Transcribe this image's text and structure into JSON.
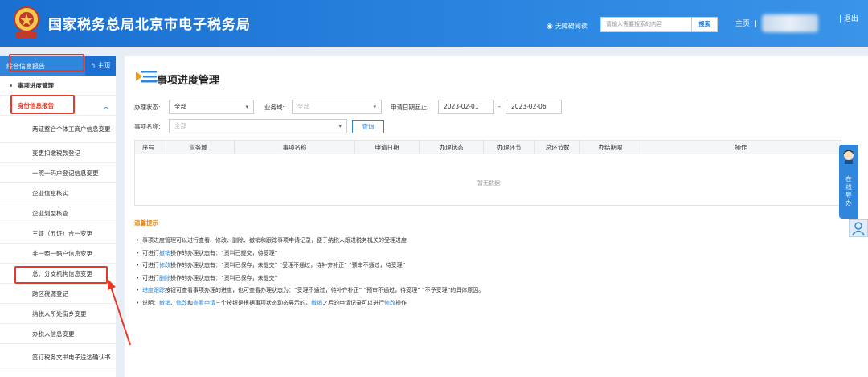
{
  "header": {
    "site_title": "国家税务总局北京市电子税务局",
    "accessibility": "无障碍阅读",
    "search_placeholder": "请输入需要搜索的内容",
    "search_button": "搜索",
    "home": "主页",
    "separator": "|",
    "logout": "| 退出"
  },
  "sidebar": {
    "head_title": "综合信息报告",
    "home_button": "主页",
    "items": [
      {
        "label": "事项进度管理",
        "level": 1
      },
      {
        "label": "身份信息报告",
        "level": 1,
        "expanded": true
      },
      {
        "label": "两证整合个体工商户信息变更",
        "level": 2
      },
      {
        "label": "变更扣缴税款登记",
        "level": 2
      },
      {
        "label": "一照一码户登记信息变更",
        "level": 2
      },
      {
        "label": "企业信息核实",
        "level": 2
      },
      {
        "label": "企业划型核查",
        "level": 2
      },
      {
        "label": "三证（五证）合一变更",
        "level": 2
      },
      {
        "label": "非一照一码户信息变更",
        "level": 2
      },
      {
        "label": "总、分支机构信息变更",
        "level": 2
      },
      {
        "label": "跨区税源登记",
        "level": 2
      },
      {
        "label": "纳税人所处街乡变更",
        "level": 2
      },
      {
        "label": "办税人信息变更",
        "level": 2
      },
      {
        "label": "签订税务文书电子送达确认书",
        "level": 2
      }
    ]
  },
  "main": {
    "page_title": "事项进度管理",
    "filters": {
      "status_label": "办理状态:",
      "status_value": "全部",
      "domain_label": "业务域:",
      "domain_value": "全部",
      "date_label": "申请日期起止:",
      "date_from": "2023-02-01",
      "date_sep": "-",
      "date_to": "2023-02-06",
      "name_label": "事项名称:",
      "name_value": "全部",
      "query_button": "查询"
    },
    "table": {
      "columns": [
        "序号",
        "业务域",
        "事项名称",
        "申请日期",
        "办理状态",
        "办理环节",
        "总环节数",
        "办结期限",
        "操作"
      ],
      "empty_text": "暂无数据"
    },
    "notice_title": "温馨提示",
    "notes": [
      {
        "parts": [
          {
            "t": "事项进度管理可以进行查看、修改、删除、撤销和跟踪事项申请记录，便于纳税人跟进税务机关的受理进度"
          }
        ]
      },
      {
        "parts": [
          {
            "t": "可进行"
          },
          {
            "t": "撤销",
            "hl": true
          },
          {
            "t": "操作的办理状态有：“资料已提交，待受理”"
          }
        ]
      },
      {
        "parts": [
          {
            "t": "可进行"
          },
          {
            "t": "修改",
            "hl": true
          },
          {
            "t": "操作的办理状态有：“资料已保存，未提交”  “受理不通过，待补齐补正”  “预审不通过，待受理”"
          }
        ]
      },
      {
        "parts": [
          {
            "t": "可进行"
          },
          {
            "t": "删除",
            "hl": true
          },
          {
            "t": "操作的办理状态有：“资料已保存，未提交”"
          }
        ]
      },
      {
        "parts": [
          {
            "t": "进度跟踪",
            "hl": true
          },
          {
            "t": "按钮可查看事项办理的进度，也可查看办理状态为：“受理不通过，待补齐补正”  “预审不通过，待受理”  “不予受理”的具体原因。"
          }
        ]
      },
      {
        "parts": [
          {
            "t": "说明："
          },
          {
            "t": "撤销",
            "hl": true
          },
          {
            "t": "、"
          },
          {
            "t": "修改",
            "hl": true
          },
          {
            "t": "和"
          },
          {
            "t": "查看申请",
            "hl": true
          },
          {
            "t": "三个按钮是根据事项状态动态展示的，"
          },
          {
            "t": "撤销",
            "hl": true
          },
          {
            "t": "之后的申请记录可以进行"
          },
          {
            "t": "修改",
            "hl": true
          },
          {
            "t": "操作"
          }
        ]
      }
    ]
  },
  "float_guide": {
    "text": "在线导办"
  },
  "colors": {
    "header": "#1a6fd0",
    "accent": "#2f86db",
    "annotation": "#e53a2a",
    "notice": "#e08a1e"
  }
}
